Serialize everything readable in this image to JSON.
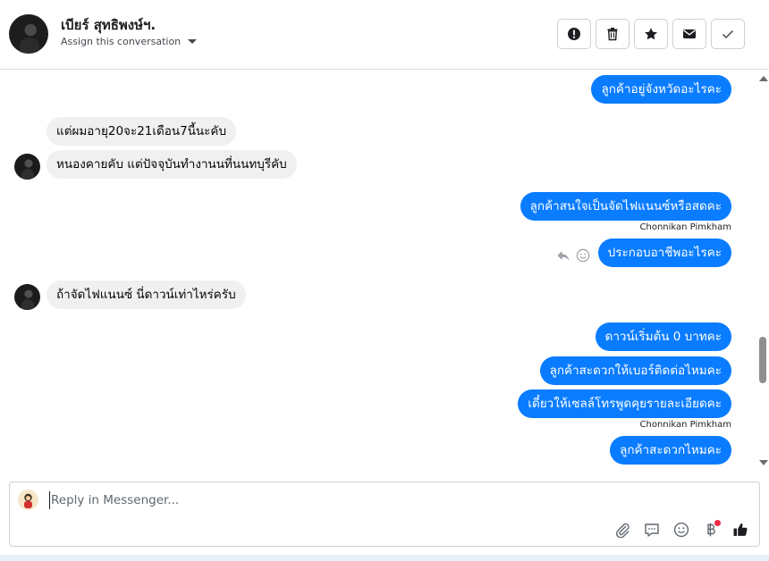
{
  "header": {
    "contact_name": "เบียร์ สุทธิพงษ์ฯ.",
    "assign_label": "Assign this conversation",
    "buttons": [
      {
        "icon": "alert-icon"
      },
      {
        "icon": "trash-icon"
      },
      {
        "icon": "star-icon"
      },
      {
        "icon": "mail-icon"
      },
      {
        "icon": "check-icon"
      }
    ]
  },
  "messages": {
    "m1": "ลูกค้าอยู่จังหวัดอะไรคะ",
    "m2": "แต่ผมอายุ20จะ21เดือน7นี้นะคับ",
    "m3": "หนองคายคับ แต่ปัจจุบันทำงานนที่นนทบุรีคับ",
    "m4": "ลูกค้าสนใจเป็นจัดไฟแนนซ์หรือสดคะ",
    "m4_sender": "Chonnikan Pimkham",
    "m5": "ประกอบอาชีพอะไรคะ",
    "m6": "ถ้าจัดไฟแนนซ์ นี่ดาวน์เท่าไหร่ครับ",
    "m7": "ดาวน์เริ่มต้น 0 บาทคะ",
    "m8": "ลูกค้าสะดวกให้เบอร์ติดต่อไหมคะ",
    "m9": "เดี๋ยวให้เซลล์โทรพูดคุยรายละเอียดคะ",
    "m9_sender": "Chonnikan Pimkham",
    "m10": "ลูกค้าสะดวกไหมคะ"
  },
  "composer": {
    "placeholder": "Reply in Messenger...",
    "tools": [
      "paperclip-icon",
      "comment-icon",
      "smiley-icon",
      "baht-icon",
      "thumbs-up-icon"
    ]
  },
  "colors": {
    "outgoing_bubble": "#0a7cff",
    "incoming_bubble": "#f0f0f0",
    "notification_dot": "#f02849"
  }
}
